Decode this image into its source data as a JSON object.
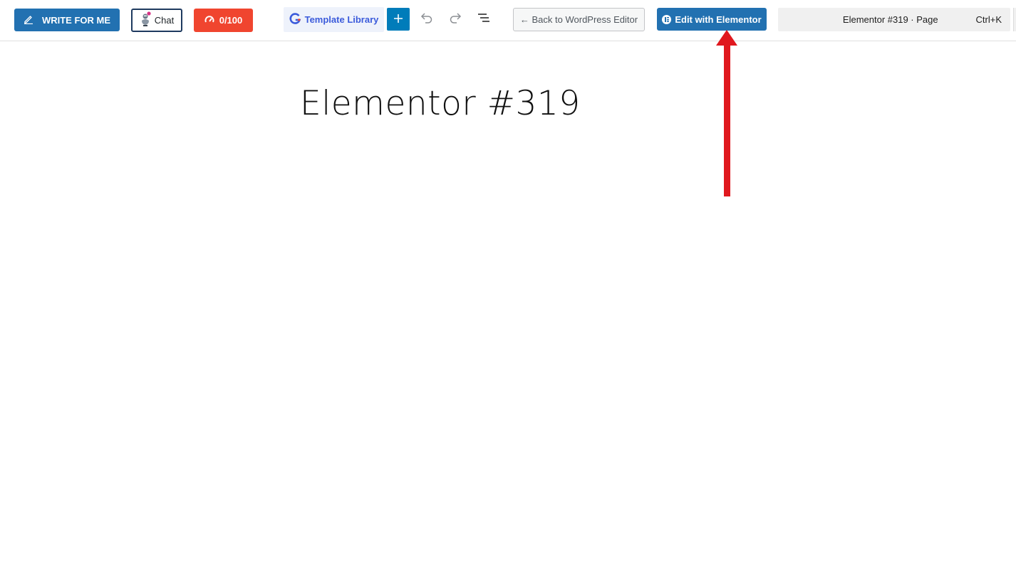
{
  "toolbar": {
    "write_label": "WRITE FOR ME",
    "chat_label": "Chat",
    "score_label": "0/100",
    "template_label": "Template Library",
    "back_label": "← Back to WordPress Editor",
    "elementor_label": "Edit with Elementor"
  },
  "command_bar": {
    "title": "Elementor #319 · Page",
    "shortcut": "Ctrl+K"
  },
  "page": {
    "title": "Elementor #319"
  },
  "colors": {
    "primary": "#2271b1",
    "score_red": "#f0452f",
    "add_blue": "#007cba",
    "annotation_arrow": "#e0181e"
  },
  "icons": {
    "write": "pencil-icon",
    "chat": "robot-icon",
    "score": "gauge-icon",
    "template": "g-logo-icon",
    "add": "plus-icon",
    "undo": "undo-icon",
    "redo": "redo-icon",
    "outline": "list-view-icon",
    "elementor": "elementor-logo-icon"
  }
}
